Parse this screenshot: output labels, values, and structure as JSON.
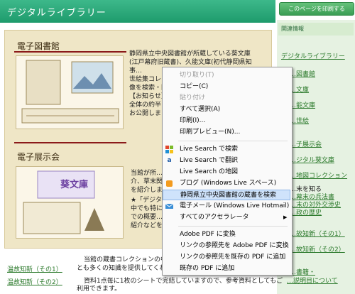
{
  "header": {
    "title": "デジタルライブラリー",
    "print_button": "このページを印刷する"
  },
  "sidebar": {
    "heading": "関連情報",
    "items": [
      {
        "label": "デジタルライブラリー"
      },
      {
        "label": "…図書館"
      },
      {
        "label": "…文庫"
      },
      {
        "label": "…能文庫"
      },
      {
        "label": "…世絵"
      },
      {
        "label": "…子展示会"
      },
      {
        "label": "…ジタル葵文庫"
      },
      {
        "label": "…地図コレクション"
      },
      {
        "label": "…末を知る"
      },
      {
        "label": "…幕末の兵法書"
      },
      {
        "label": "…末の対外交渉史"
      },
      {
        "label": "…政の歴史"
      },
      {
        "label": "…故知新（その1）"
      },
      {
        "label": "…故知新（その2）"
      },
      {
        "label": "…書籍・"
      },
      {
        "label": "…説明目について"
      }
    ]
  },
  "main": {
    "section1": {
      "title": "電子図書館",
      "lines": [
        "静岡県立中央図書館が所蔵している葵文庫",
        "(江戸幕府旧蔵書)、久能文庫(初代静岡県知",
        "事…",
        "世絵集コレク…",
        "像を検索・閲…",
        "【お知らせ】",
        "全体の約半…",
        "お公開しま…"
      ]
    },
    "section2": {
      "title": "電子展示会",
      "lines": [
        "当館が所…",
        "介、草末関…",
        "を紹介しま…",
        "★「デジタル…",
        "中でも特に…",
        "での概要…",
        "紹介などを…"
      ],
      "thumb_caption": "葵文庫"
    },
    "bottom_links": [
      "温故知新（その1）",
      "温故知新（その2）"
    ],
    "bottom_text": [
      "当館の蔵書コレクションの中で…",
      "とも多くの知識を提供してくれる…",
      "資料1点毎に1枚のシートで完結していますので、参考資料としてもご",
      "利用できます。"
    ]
  },
  "context_menu": {
    "items": [
      {
        "label": "切り取り(T)",
        "disabled": true
      },
      {
        "label": "コピー(C)",
        "disabled": false
      },
      {
        "label": "貼り付け",
        "disabled": true
      },
      {
        "label": "すべて選択(A)",
        "disabled": false
      },
      {
        "label": "印刷(I)...",
        "disabled": false
      },
      {
        "label": "印刷プレビュー(N)...",
        "disabled": false
      },
      {
        "label": "Live Search で検索",
        "icon": "windows-icon"
      },
      {
        "label": "Live Search で翻訳",
        "icon": "translate-icon"
      },
      {
        "label": "Live Search の地図",
        "icon": ""
      },
      {
        "label": "ブログ (Windows Live スペース)",
        "icon": "blog-icon"
      },
      {
        "label": "静岡県立中央図書館の蔵書を検索",
        "icon": "",
        "highlighted": true
      },
      {
        "label": "電子メール (Windows Live Hotmail)",
        "icon": "mail-icon"
      },
      {
        "label": "すべてのアクセラレータ",
        "icon": "",
        "submenu": true
      },
      {
        "label": "Adobe PDF に変換",
        "icon": ""
      },
      {
        "label": "リンクの参照先を Adobe PDF に変換",
        "icon": ""
      },
      {
        "label": "リンクの参照先を既存の PDF に追加",
        "icon": ""
      },
      {
        "label": "既存の PDF に追加",
        "icon": ""
      }
    ],
    "submenu_arrow": "▶"
  },
  "colors": {
    "header": "#1e9b6c",
    "accent_red": "#8b1a1a",
    "panel": "#efe6c6",
    "highlight": "#cfe3fb"
  }
}
